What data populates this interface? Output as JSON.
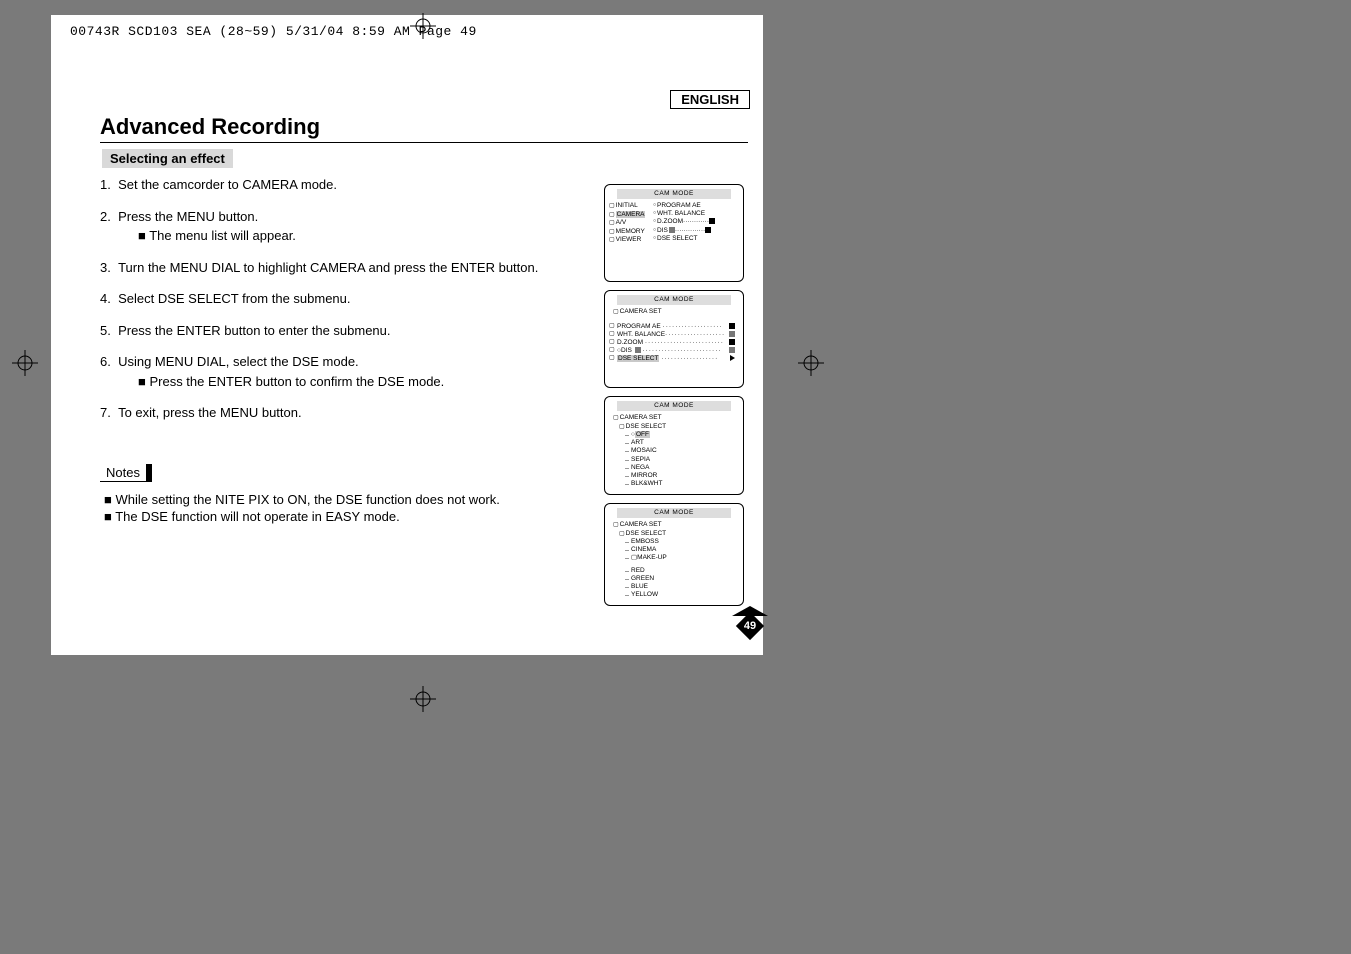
{
  "slug": "00743R SCD103 SEA (28~59)  5/31/04 8:59 AM  Page 49",
  "language_label": "ENGLISH",
  "title": "Advanced Recording",
  "section_heading": "Selecting an effect",
  "steps": [
    {
      "n": "1.",
      "text": "Set the camcorder to CAMERA mode."
    },
    {
      "n": "2.",
      "text": "Press the MENU button.",
      "sub": [
        "The menu list will appear."
      ]
    },
    {
      "n": "3.",
      "text": "Turn the MENU DIAL to highlight CAMERA and press the ENTER button."
    },
    {
      "n": "4.",
      "text": "Select DSE SELECT from the submenu."
    },
    {
      "n": "5.",
      "text": "Press the ENTER button to enter the submenu."
    },
    {
      "n": "6.",
      "text": "Using MENU DIAL, select the DSE mode.",
      "sub": [
        "Press the ENTER button to confirm the DSE mode."
      ]
    },
    {
      "n": "7.",
      "text": "To exit, press the MENU button."
    }
  ],
  "notes_label": "Notes",
  "notes": [
    "While setting the NITE PIX to ON, the DSE function does not work.",
    "The DSE function will not operate in EASY mode."
  ],
  "page_number": "49",
  "screens": {
    "hdr": "CAM  MODE",
    "s1": {
      "left": [
        "INITIAL",
        "CAMERA",
        "A/V",
        "MEMORY",
        "VIEWER"
      ],
      "right": [
        "PROGRAM AE",
        "WHT. BALANCE",
        "D.ZOOM",
        "DIS",
        "DSE SELECT"
      ],
      "selected_left": "CAMERA"
    },
    "s2": {
      "title": "CAMERA SET",
      "rows": [
        "PROGRAM AE",
        "WHT. BALANCE",
        "D.ZOOM",
        "DIS",
        "DSE SELECT"
      ]
    },
    "s3": {
      "path": [
        "CAMERA SET",
        "DSE SELECT"
      ],
      "options": [
        "OFF",
        "ART",
        "MOSAIC",
        "SEPIA",
        "NEGA",
        "MIRROR",
        "BLK&WHT"
      ],
      "selected": "OFF"
    },
    "s4": {
      "path": [
        "CAMERA SET",
        "DSE SELECT"
      ],
      "groupA": [
        "EMBOSS",
        "CINEMA",
        "MAKE-UP"
      ],
      "groupA_selected": "MAKE-UP",
      "groupB": [
        "RED",
        "GREEN",
        "BLUE",
        "YELLOW"
      ]
    }
  }
}
